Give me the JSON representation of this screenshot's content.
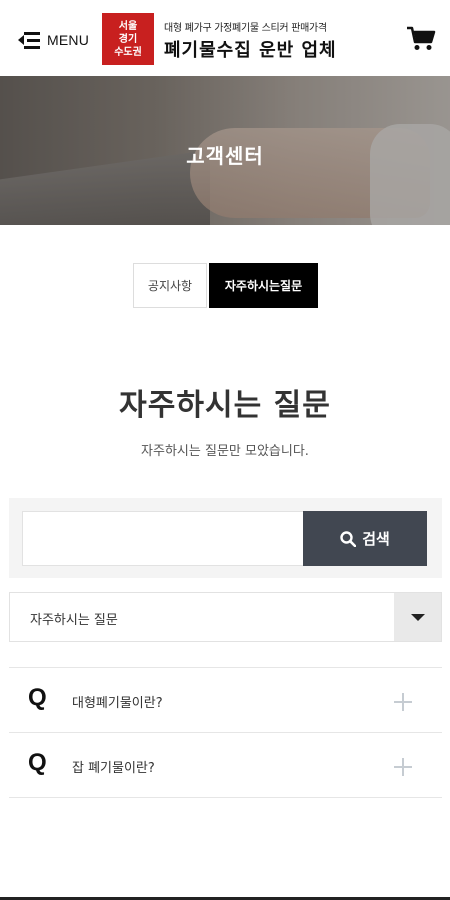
{
  "header": {
    "menu_label": "MENU",
    "region_badge": [
      "서울",
      "경기",
      "수도권"
    ],
    "tagline": "대형 폐가구 가정폐기물 스티커 판매가격",
    "company_name": "폐기물수집 운반 업체"
  },
  "hero": {
    "title": "고객센터"
  },
  "tabs": [
    {
      "label": "공지사항",
      "active": false
    },
    {
      "label": "자주하시는질문",
      "active": true
    }
  ],
  "section": {
    "title": "자주하시는 질문",
    "description": "자주하시는 질문만 모았습니다."
  },
  "search": {
    "value": "",
    "placeholder": "",
    "button_label": "검색"
  },
  "category_select": {
    "selected": "자주하시는 질문"
  },
  "faq": [
    {
      "marker": "Q",
      "question": "대형폐기물이란?"
    },
    {
      "marker": "Q",
      "question": "잡 폐기물이란?"
    }
  ],
  "colors": {
    "region_badge_bg": "#c8201f",
    "active_tab_bg": "#000000",
    "search_button_bg": "#414751",
    "plus_icon": "#c6ccd2"
  }
}
